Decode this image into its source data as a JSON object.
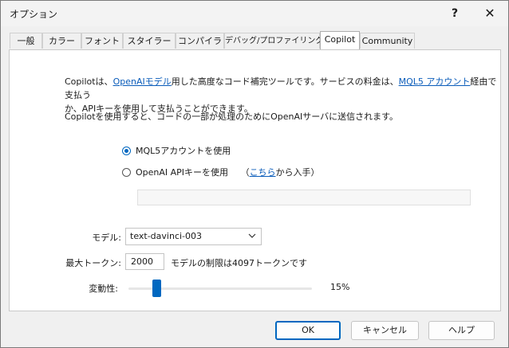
{
  "window": {
    "title": "オプション",
    "help_glyph": "?",
    "close_glyph": "✕"
  },
  "tabs": [
    {
      "label": "一般",
      "active": false
    },
    {
      "label": "カラー",
      "active": false
    },
    {
      "label": "フォント",
      "active": false
    },
    {
      "label": "スタイラー",
      "active": false
    },
    {
      "label": "コンパイラ",
      "active": false
    },
    {
      "label": "デバッグ/プロファイリング",
      "active": false
    },
    {
      "label": "Copilot",
      "active": true
    },
    {
      "label": "Community",
      "active": false
    }
  ],
  "copilot": {
    "intro": {
      "t1": "Copilotは、",
      "link1": "OpenAIモデル",
      "t2": "用した高度なコード補完ツールです。サービスの料金は、",
      "link2": "MQL5 アカウント",
      "t3": "経由で支払う",
      "line2": "か、APIキーを使用して支払うことができます。"
    },
    "notice": "Copilotを使用すると、コードの一部が処理のためにOpenAIサーバに送信されます。",
    "radio_mql5": "MQL5アカウントを使用",
    "radio_openai": "OpenAI APIキーを使用",
    "obtain_prefix": "（",
    "obtain_link": "こちら",
    "obtain_suffix": "から入手）",
    "api_key_value": "",
    "selected_option": "mql5",
    "model_label": "モデル:",
    "model_value": "text-davinci-003",
    "max_tokens_label": "最大トークン:",
    "max_tokens_value": "2000",
    "max_tokens_note": "モデルの制限は4097トークンです",
    "variability_label": "変動性:",
    "variability_value": "15%",
    "variability_fraction": 0.15
  },
  "buttons": {
    "ok": "OK",
    "cancel": "キャンセル",
    "help": "ヘルプ"
  }
}
